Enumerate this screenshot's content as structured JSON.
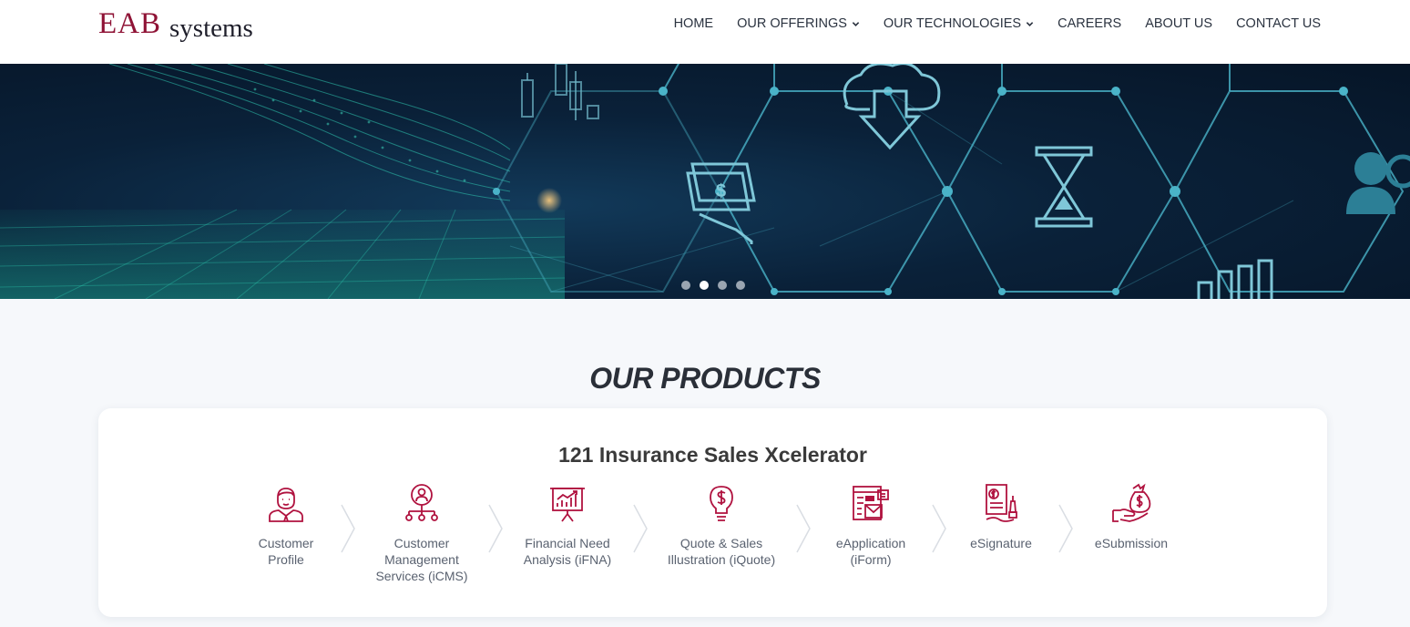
{
  "header": {
    "logo": {
      "brand": "EAB",
      "suffix": "systems"
    },
    "nav": [
      {
        "label": "HOME",
        "dropdown": false
      },
      {
        "label": "OUR OFFERINGS",
        "dropdown": true
      },
      {
        "label": "OUR TECHNOLOGIES",
        "dropdown": true
      },
      {
        "label": "CAREERS",
        "dropdown": false
      },
      {
        "label": "ABOUT US",
        "dropdown": false
      },
      {
        "label": "CONTACT US",
        "dropdown": false
      }
    ]
  },
  "hero": {
    "slide_count": 4,
    "active_slide": 2,
    "icons": [
      "money-hand-icon",
      "cloud-download-icon",
      "hourglass-icon",
      "user-search-icon",
      "bar-chart-icon",
      "candlestick-icon"
    ]
  },
  "products": {
    "section_title": "OUR PRODUCTS",
    "card_title": "121 Insurance Sales Xcelerator",
    "steps": [
      {
        "label": "Customer\nProfile",
        "icon": "customer-profile-icon"
      },
      {
        "label": "Customer\nManagement\nServices (iCMS)",
        "icon": "customer-network-icon"
      },
      {
        "label": "Financial Need\nAnalysis (iFNA)",
        "icon": "growth-chart-icon"
      },
      {
        "label": "Quote & Sales\nIllustration (iQuote)",
        "icon": "lightbulb-dollar-icon"
      },
      {
        "label": "eApplication\n(iForm)",
        "icon": "eform-icon"
      },
      {
        "label": "eSignature",
        "icon": "esignature-icon"
      },
      {
        "label": "eSubmission",
        "icon": "money-bag-hand-icon"
      }
    ]
  },
  "colors": {
    "brand": "#8f1336",
    "icon_accent": "#b0123f",
    "nav_text": "#2b3340",
    "hero_dark": "#061527",
    "hero_line": "#3ec7d6"
  }
}
